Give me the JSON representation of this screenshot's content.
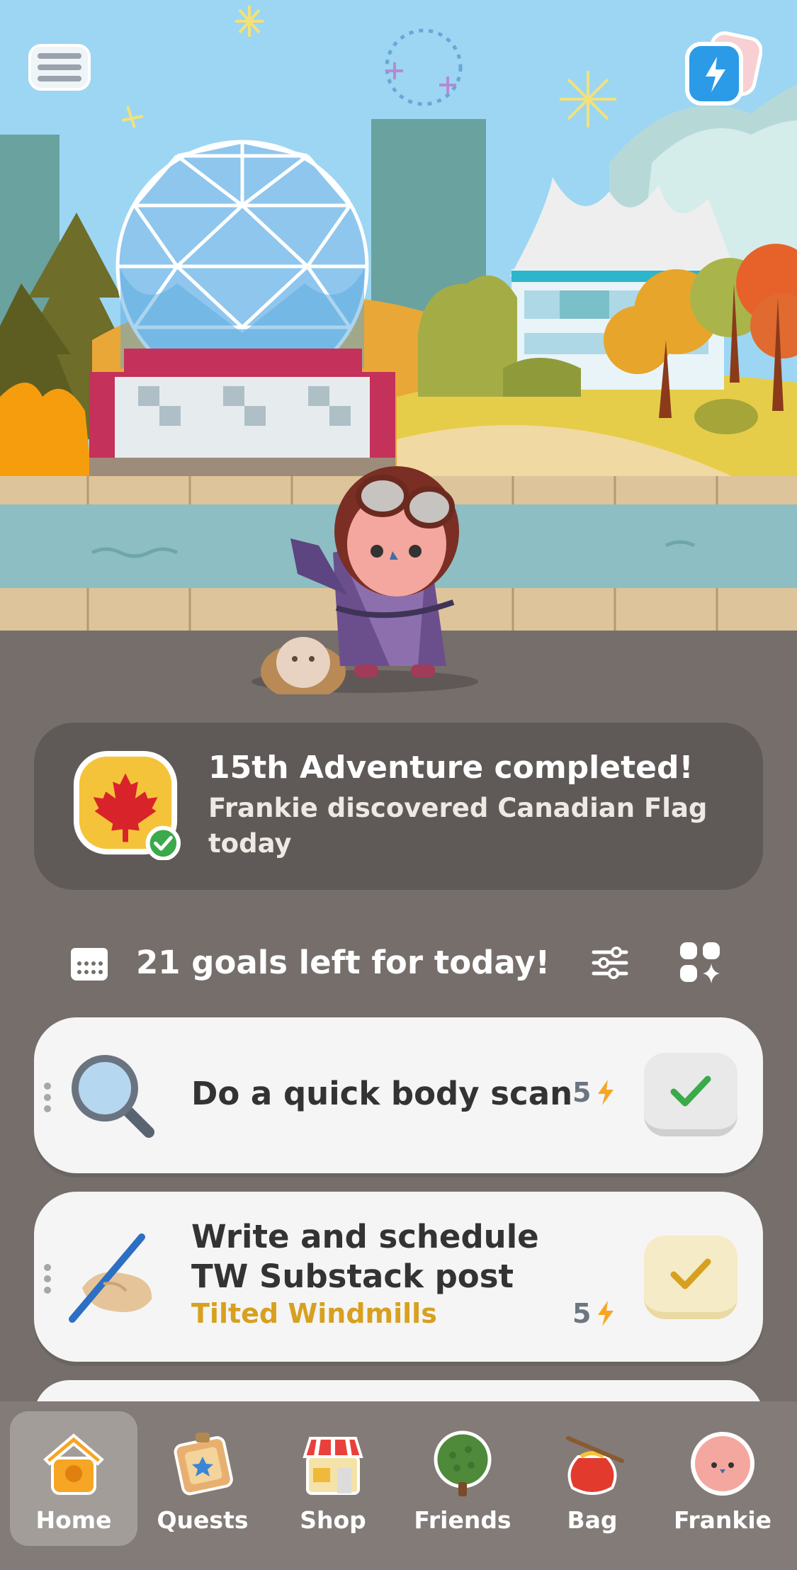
{
  "adventure": {
    "title": "15th Adventure completed!",
    "subtitle": "Frankie discovered Canadian Flag today"
  },
  "goals_header": {
    "text": "21 goals left for today!"
  },
  "goals": [
    {
      "title": "Do a quick body scan",
      "tag": "",
      "points": "5",
      "icon": "magnifier-icon",
      "status": "gray"
    },
    {
      "title": "Write and schedule TW Substack post",
      "tag": "Tilted Windmills",
      "points": "5",
      "icon": "writing-hand-icon",
      "status": "yellow"
    }
  ],
  "nav": [
    {
      "label": "Home",
      "icon": "birdhouse-icon",
      "active": true
    },
    {
      "label": "Quests",
      "icon": "map-icon"
    },
    {
      "label": "Shop",
      "icon": "shop-icon"
    },
    {
      "label": "Friends",
      "icon": "tree-icon"
    },
    {
      "label": "Bag",
      "icon": "bag-icon"
    },
    {
      "label": "Frankie",
      "icon": "pet-face-icon"
    }
  ],
  "colors": {
    "background": "#756e6b",
    "sky": "#9cd6f3",
    "accent_yellow": "#f5c33a",
    "check_green": "#3aaa4a",
    "energy_blue": "#2b9be8"
  }
}
